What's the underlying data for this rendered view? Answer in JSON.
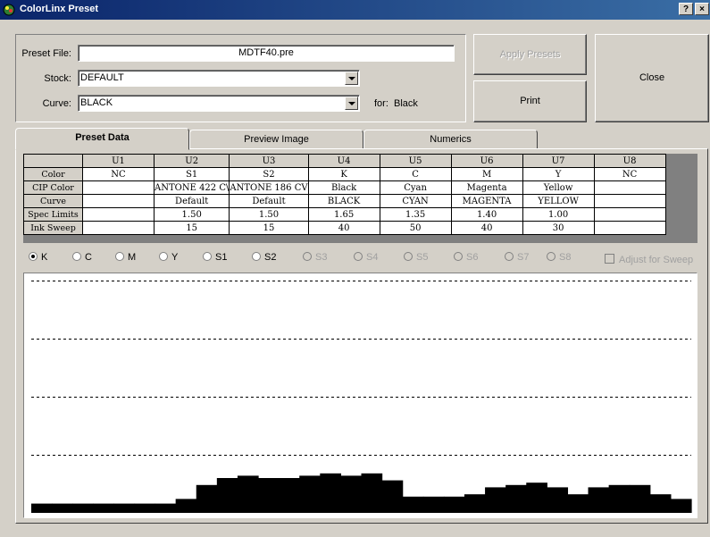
{
  "window": {
    "title": "ColorLinx Preset",
    "help_label": "?",
    "close_label": "×"
  },
  "form": {
    "preset_file_label": "Preset File:",
    "preset_file_value": "MDTF40.pre",
    "stock_label": "Stock:",
    "stock_value": "DEFAULT",
    "curve_label": "Curve:",
    "curve_value": "BLACK",
    "for_label": "for:",
    "for_value": "Black"
  },
  "buttons": {
    "apply_presets": "Apply Presets",
    "print": "Print",
    "close": "Close"
  },
  "tabs": [
    {
      "label": "Preset Data",
      "active": true
    },
    {
      "label": "Preview Image",
      "active": false
    },
    {
      "label": "Numerics",
      "active": false
    }
  ],
  "table": {
    "columns": [
      "U1",
      "U2",
      "U3",
      "U4",
      "U5",
      "U6",
      "U7",
      "U8"
    ],
    "rows": [
      {
        "label": "Color",
        "cells": [
          "NC",
          "S1",
          "S2",
          "K",
          "C",
          "M",
          "Y",
          "NC"
        ]
      },
      {
        "label": "CIP Color",
        "cells": [
          "",
          "ANTONE 422 C\\",
          "ANTONE 186 CV",
          "Black",
          "Cyan",
          "Magenta",
          "Yellow",
          ""
        ]
      },
      {
        "label": "Curve",
        "cells": [
          "",
          "Default",
          "Default",
          "BLACK",
          "CYAN",
          "MAGENTA",
          "YELLOW",
          ""
        ]
      },
      {
        "label": "Spec Limits",
        "cells": [
          "",
          "1.50",
          "1.50",
          "1.65",
          "1.35",
          "1.40",
          "1.00",
          ""
        ]
      },
      {
        "label": "Ink Sweep",
        "cells": [
          "",
          "15",
          "15",
          "40",
          "50",
          "40",
          "30",
          ""
        ]
      }
    ]
  },
  "radios": [
    {
      "label": "K",
      "checked": true,
      "enabled": true
    },
    {
      "label": "C",
      "checked": false,
      "enabled": true
    },
    {
      "label": "M",
      "checked": false,
      "enabled": true
    },
    {
      "label": "Y",
      "checked": false,
      "enabled": true
    },
    {
      "label": "S1",
      "checked": false,
      "enabled": true
    },
    {
      "label": "S2",
      "checked": false,
      "enabled": true
    },
    {
      "label": "S3",
      "checked": false,
      "enabled": false
    },
    {
      "label": "S4",
      "checked": false,
      "enabled": false
    },
    {
      "label": "S5",
      "checked": false,
      "enabled": false
    },
    {
      "label": "S6",
      "checked": false,
      "enabled": false
    },
    {
      "label": "S7",
      "checked": false,
      "enabled": false
    },
    {
      "label": "S8",
      "checked": false,
      "enabled": false
    }
  ],
  "adjust_for_sweep": {
    "label": "Adjust for Sweep",
    "checked": false,
    "enabled": false
  },
  "chart_data": {
    "type": "bar",
    "title": "",
    "xlabel": "",
    "ylabel": "",
    "ylim": [
      0,
      100
    ],
    "gridlines": [
      25,
      50,
      75,
      100
    ],
    "grid": true,
    "color": "#000000",
    "values": [
      4,
      4,
      4,
      4,
      4,
      4,
      4,
      6,
      12,
      15,
      16,
      15,
      15,
      16,
      17,
      16,
      17,
      14,
      7,
      7,
      7,
      8,
      11,
      12,
      13,
      11,
      8,
      11,
      12,
      12,
      8,
      6
    ]
  }
}
